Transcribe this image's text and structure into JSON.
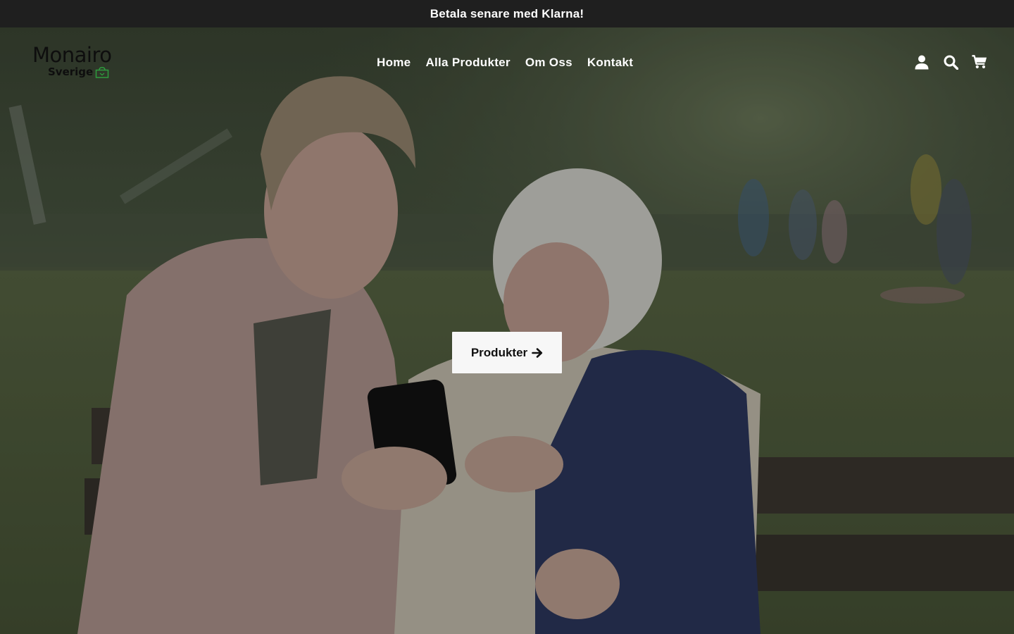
{
  "announcement": {
    "text": "Betala senare med Klarna!",
    "background": "#1f1f1f"
  },
  "header": {
    "logo": {
      "main": "Monairo",
      "sub": "Sverige",
      "accent_color": "#2e9c3e"
    },
    "nav": [
      {
        "label": "Home"
      },
      {
        "label": "Alla Produkter"
      },
      {
        "label": "Om Oss"
      },
      {
        "label": "Kontakt"
      }
    ],
    "icons": [
      "account-icon",
      "search-icon",
      "cart-icon"
    ]
  },
  "hero": {
    "image_alt": "",
    "cta_label": "Produkter",
    "cta_icon": "arrow-right-icon"
  }
}
